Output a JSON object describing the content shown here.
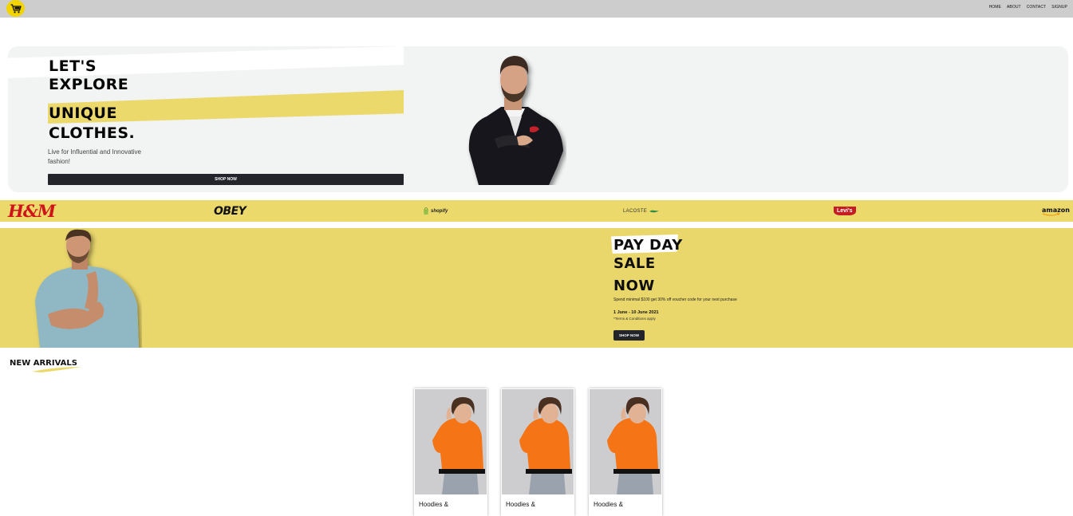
{
  "nav": {
    "logo_icon": "shopping-cart-icon",
    "links": [
      "HOME",
      "ABOUT",
      "CONTACT",
      "SIGNUP"
    ]
  },
  "hero": {
    "line1": "LET'S",
    "line2": "EXPLORE",
    "line3": "UNIQUE",
    "line4": "CLOTHES.",
    "subtitle": "Live for Influential and Innovative fashion!",
    "button": "SHOP NOW"
  },
  "brands": {
    "hm": "H&M",
    "obey": "OBEY",
    "shopify": "shopify",
    "lacoste": "LACOSTE",
    "levis": "Levi's",
    "amazon": "amazon"
  },
  "sale": {
    "line1": "PAY DAY",
    "line2": "SALE",
    "line3": "NOW",
    "description": "Spend minimal $100 get 30% off voucher code for your next purchase",
    "dates": "1 June - 10 June 2021",
    "terms": "*Terms & Conditions apply",
    "button": "SHOP NOW"
  },
  "arrivals": {
    "title": "NEW ARRIVALS",
    "products": [
      {
        "name": "Hoodies &"
      },
      {
        "name": "Hoodies &"
      },
      {
        "name": "Hoodies &"
      }
    ]
  },
  "colors": {
    "accent_yellow": "#ebd96b",
    "dark_button": "#23252b",
    "navbar": "#cdcdcd"
  }
}
